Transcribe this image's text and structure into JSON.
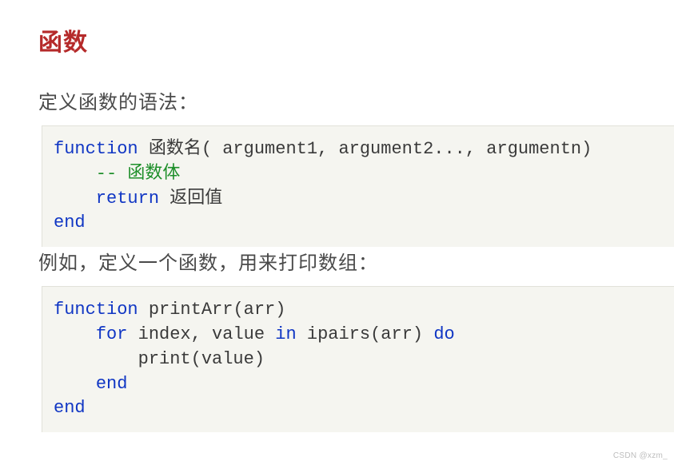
{
  "title": "函数",
  "intro1": "定义函数的语法：",
  "intro2": "例如，定义一个函数，用来打印数组：",
  "code1": {
    "l1_kw": "function",
    "l1_rest": " 函数名( argument1, argument2..., argumentn)",
    "l2_cm": "    -- 函数体",
    "l3_kw": "    return",
    "l3_rest": " 返回值",
    "l4_kw": "end"
  },
  "code2": {
    "l1_kw": "function",
    "l1_rest": " printArr(arr)",
    "l2_a": "    ",
    "l2_kw1": "for",
    "l2_b": " index, value ",
    "l2_kw2": "in",
    "l2_c": " ipairs(arr) ",
    "l2_kw3": "do",
    "l3": "        print(value)",
    "l4_a": "    ",
    "l4_kw": "end",
    "l5_kw": "end"
  },
  "watermark": "CSDN @xzm_"
}
